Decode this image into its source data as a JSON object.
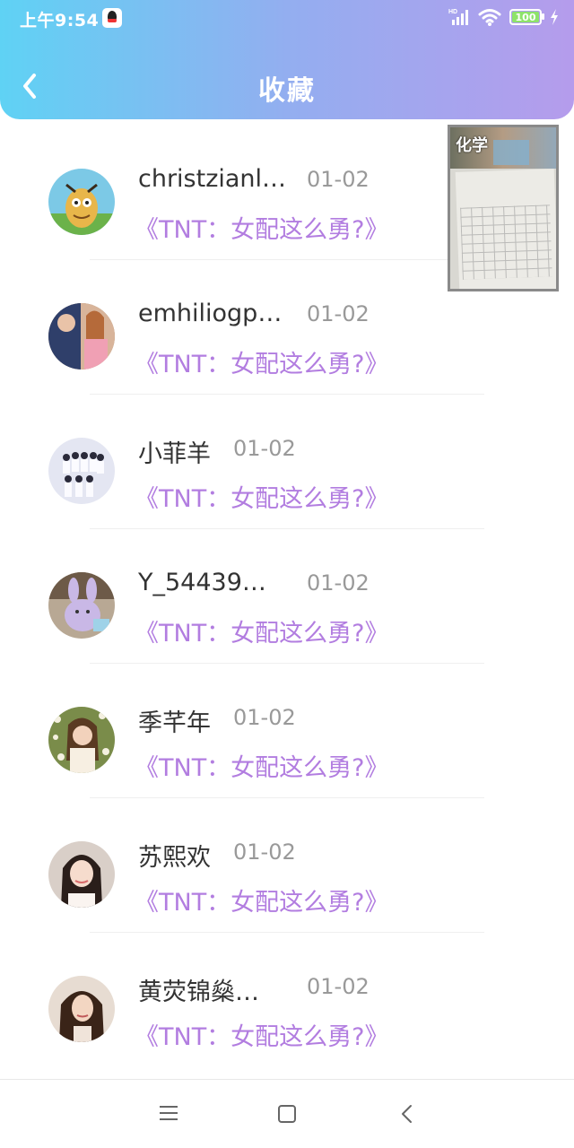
{
  "status_bar": {
    "time": "上午9:54",
    "battery": "100",
    "signal_label": "HD"
  },
  "header": {
    "title": "收藏",
    "accent_start": "#5fd2f4",
    "accent_end": "#b59cec"
  },
  "pip": {
    "label": "化学"
  },
  "favorites": [
    {
      "name": "christzianl…",
      "date": "01-02",
      "book": "《TNT：女配这么勇?》",
      "avatar_icon": "cartoon-avatar"
    },
    {
      "name": "emhiliogp…",
      "date": "01-02",
      "book": "《TNT：女配这么勇?》",
      "avatar_icon": "couple-photo-avatar"
    },
    {
      "name": "小菲羊",
      "date": "01-02",
      "book": "《TNT：女配这么勇?》",
      "avatar_icon": "group-photo-avatar"
    },
    {
      "name": "Y_54439…",
      "date": "01-02",
      "book": "《TNT：女配这么勇?》",
      "avatar_icon": "plush-toy-avatar"
    },
    {
      "name": "季芊年",
      "date": "01-02",
      "book": "《TNT：女配这么勇?》",
      "avatar_icon": "flower-girl-avatar"
    },
    {
      "name": "苏熙欢",
      "date": "01-02",
      "book": "《TNT：女配这么勇?》",
      "avatar_icon": "girl-portrait-avatar"
    },
    {
      "name": "黄荧锦燊…",
      "date": "01-02",
      "book": "《TNT：女配这么勇?》",
      "avatar_icon": "woman-portrait-avatar"
    }
  ],
  "nav": {
    "icons": [
      "menu-icon",
      "home-icon",
      "back-icon"
    ]
  }
}
